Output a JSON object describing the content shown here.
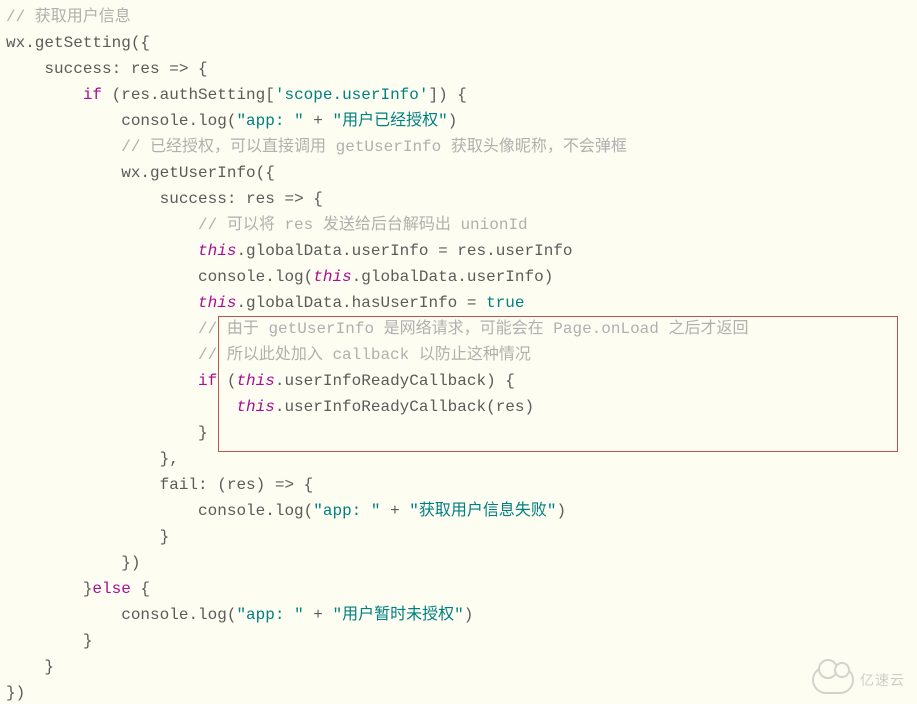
{
  "watermark": "亿速云",
  "code": {
    "l01_cm": "// 获取用户信息",
    "l02_a": "wx",
    "l02_b": ".getSetting({",
    "l03_a": "    success",
    "l03_b": ": ",
    "l03_c": "res",
    "l03_d": " => {",
    "l04_a": "        ",
    "l04_b": "if",
    "l04_c": " (",
    "l04_d": "res",
    "l04_e": ".authSetting[",
    "l04_f": "'scope.userInfo'",
    "l04_g": "]) {",
    "l05_a": "            console",
    "l05_b": ".log(",
    "l05_c": "\"app: \"",
    "l05_d": " + ",
    "l05_e": "\"用户已经授权\"",
    "l05_f": ")",
    "l06_cm": "            // 已经授权，可以直接调用 getUserInfo 获取头像昵称，不会弹框",
    "l07_a": "            wx",
    "l07_b": ".getUserInfo({",
    "l08_a": "                success",
    "l08_b": ": ",
    "l08_c": "res",
    "l08_d": " => {",
    "l09_cm": "                    // 可以将 res 发送给后台解码出 unionId",
    "l10_a": "                    ",
    "l10_b": "this",
    "l10_c": ".globalData.userInfo = ",
    "l10_d": "res",
    "l10_e": ".userInfo",
    "l11_a": "                    console",
    "l11_b": ".log(",
    "l11_c": "this",
    "l11_d": ".globalData.userInfo)",
    "l12_a": "                    ",
    "l12_b": "this",
    "l12_c": ".globalData.hasUserInfo = ",
    "l12_d": "true",
    "l13_cm": "                    // 由于 getUserInfo 是网络请求，可能会在 Page.onLoad 之后才返回",
    "l14_cm": "                    // 所以此处加入 callback 以防止这种情况",
    "l15_a": "                    ",
    "l15_b": "if",
    "l15_c": " (",
    "l15_d": "this",
    "l15_e": ".userInfoReadyCallback) {",
    "l16_a": "                        ",
    "l16_b": "this",
    "l16_c": ".userInfoReadyCallback(",
    "l16_d": "res",
    "l16_e": ")",
    "l17_a": "                    }",
    "l18_a": "                },",
    "l19_a": "                fail",
    "l19_b": ": (",
    "l19_c": "res",
    "l19_d": ") => {",
    "l20_a": "                    console",
    "l20_b": ".log(",
    "l20_c": "\"app: \"",
    "l20_d": " + ",
    "l20_e": "\"获取用户信息失败\"",
    "l20_f": ")",
    "l21_a": "                }",
    "l22_a": "            })",
    "l23_a": "        }",
    "l23_b": "else",
    "l23_c": " {",
    "l24_a": "            console",
    "l24_b": ".log(",
    "l24_c": "\"app: \"",
    "l24_d": " + ",
    "l24_e": "\"用户暂时未授权\"",
    "l24_f": ")",
    "l25_a": "        }",
    "l26_a": "    }",
    "l27_a": "})"
  }
}
